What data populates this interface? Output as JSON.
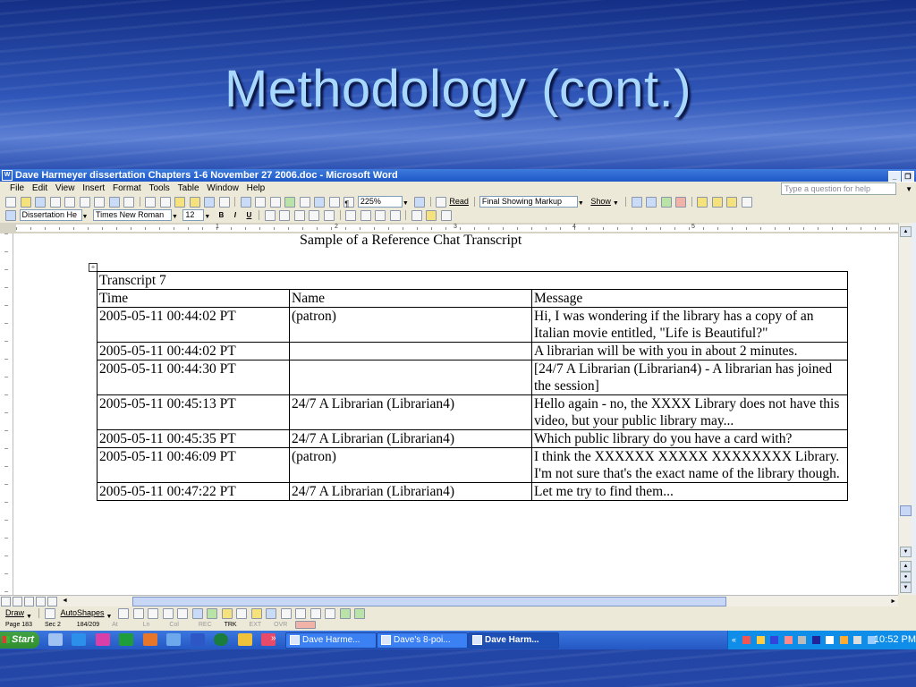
{
  "slide": {
    "title": "Methodology (cont.)"
  },
  "window": {
    "title": "Dave Harmeyer dissertation Chapters 1-6 November 27 2006.doc - Microsoft Word",
    "menu": [
      "File",
      "Edit",
      "View",
      "Insert",
      "Format",
      "Tools",
      "Table",
      "Window",
      "Help"
    ],
    "help_placeholder": "Type a question for help",
    "toolbar": {
      "zoom": "225%",
      "read_label": "Read",
      "markup_mode": "Final Showing Markup",
      "show_label": "Show"
    },
    "formatting": {
      "style": "Dissertation He",
      "font": "Times New Roman",
      "size": "12",
      "bold": "B",
      "italic": "I",
      "underline": "U"
    },
    "ruler_numbers": [
      "1",
      "2",
      "3",
      "4",
      "5"
    ]
  },
  "document": {
    "heading": "Sample of a Reference Chat Transcript",
    "table": {
      "caption": "Transcript 7",
      "headers": [
        "Time",
        "Name",
        "Message"
      ],
      "rows": [
        [
          "2005-05-11 00:44:02 PT",
          "(patron)",
          "Hi, I was wondering if the library has a copy of an Italian movie entitled, \"Life is Beautiful?\""
        ],
        [
          "2005-05-11 00:44:02 PT",
          "",
          "A librarian will be with you in about 2 minutes."
        ],
        [
          "2005-05-11 00:44:30 PT",
          "",
          "[24/7 A Librarian (Librarian4) - A librarian has joined the session]"
        ],
        [
          "2005-05-11 00:45:13 PT",
          "24/7 A Librarian (Librarian4)",
          "Hello again - no, the XXXX Library does not have this video, but your public library may..."
        ],
        [
          "2005-05-11 00:45:35 PT",
          "24/7 A Librarian (Librarian4)",
          "Which public library do you have a card with?"
        ],
        [
          "2005-05-11 00:46:09 PT",
          "(patron)",
          "I think the XXXXXX XXXXX XXXXXXXX Library. I'm not sure that's the exact name of the library though."
        ],
        [
          "2005-05-11 00:47:22 PT",
          "24/7 A Librarian (Librarian4)",
          "Let me try to find them..."
        ]
      ]
    }
  },
  "drawbar": {
    "draw_label": "Draw",
    "autoshapes_label": "AutoShapes"
  },
  "statusbar": {
    "page": "Page 183",
    "sec": "Sec 2",
    "pages": "184/209",
    "at": "At",
    "ln": "Ln",
    "col": "Col",
    "rec": "REC",
    "trk": "TRK",
    "ext": "EXT",
    "ovr": "OVR"
  },
  "taskbar": {
    "start_label": "Start",
    "tasks": [
      "Dave Harme...",
      "Dave's 8-poi...",
      "Dave Harm..."
    ],
    "clock": "10:52 PM"
  }
}
